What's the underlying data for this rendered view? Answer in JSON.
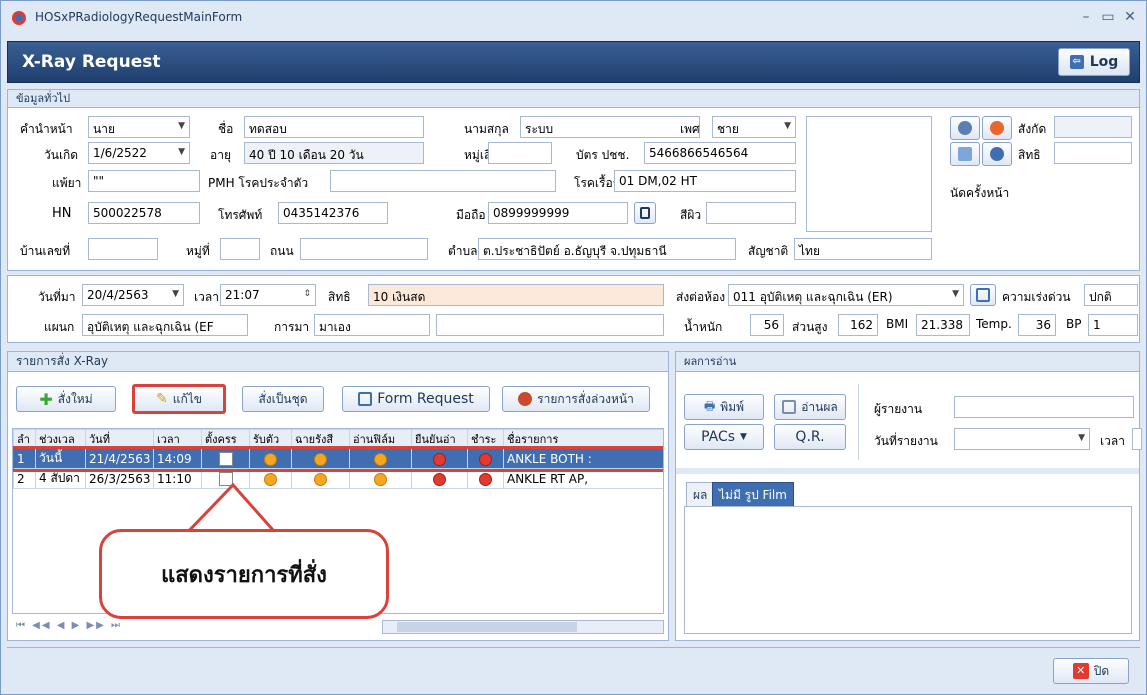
{
  "window": {
    "title": "HOSxPRadiologyRequestMainForm"
  },
  "header": {
    "title": "X-Ray Request",
    "log_label": "Log"
  },
  "general": {
    "section_title": "ข้อมูลทั่วไป",
    "prefix_label": "คำนำหน้า",
    "prefix_value": "นาย",
    "name_label": "ชื่อ",
    "name_value": "ทดสอบ",
    "surname_label": "นามสกุล",
    "surname_value": "ระบบ",
    "sex_label": "เพศ",
    "sex_value": "ชาย",
    "birth_label": "วันเกิด",
    "birth_value": "1/6/2522",
    "age_label": "อายุ",
    "age_value": "40 ปี 10 เดือน 20 วัน",
    "blood_label": "หมู่เลือด",
    "blood_value": "",
    "cid_label": "บัตร ปชช.",
    "cid_value": "5466866546564",
    "allergy_label": "แพ้ยา",
    "allergy_value": "\"\"",
    "pmh_label": "PMH โรคประจำตัว",
    "pmh_value": "",
    "chronic_label": "โรคเรื้อรัง",
    "chronic_value": "01 DM,02 HT",
    "hn_label": "HN",
    "hn_value": "500022578",
    "phone_label": "โทรศัพท์",
    "phone_value": "0435142376",
    "mobile_label": "มือถือ",
    "mobile_value": "0899999999",
    "skin_label": "สีผิว",
    "skin_value": "",
    "house_label": "บ้านเลขที่",
    "house_value": "",
    "moo_label": "หมู่ที่",
    "moo_value": "",
    "road_label": "ถนน",
    "road_value": "",
    "tambon_label": "ตำบล",
    "tambon_value": "ต.ประชาธิปัตย์ อ.ธัญบุรี จ.ปทุมธานี",
    "nation_label": "สัญชาติ",
    "nation_value": "ไทย",
    "affil_label": "สังกัด",
    "right_label": "สิทธิ",
    "appoint_label": "นัดครั้งหน้า"
  },
  "visit": {
    "date_label": "วันที่มา",
    "date_value": "20/4/2563",
    "time_label": "เวลา",
    "time_value": "21:07",
    "right_label": "สิทธิ",
    "right_value": "10 เงินสด",
    "send_label": "ส่งต่อห้อง",
    "send_value": "011 อุบัติเหตุ และฉุกเฉิน (ER)",
    "urgency_label": "ความเร่งด่วน",
    "urgency_value": "ปกติ",
    "dept_label": "แผนก",
    "dept_value": "อุบัติเหตุ และฉุกเฉิน (EF",
    "come_label": "การมา",
    "come_value": "มาเอง",
    "weight_label": "น้ำหนัก",
    "weight_value": "56",
    "height_label": "ส่วนสูง",
    "height_value": "162",
    "bmi_label": "BMI",
    "bmi_value": "21.338",
    "temp_label": "Temp.",
    "temp_value": "36",
    "bp_label": "BP",
    "bp_value": "1"
  },
  "orders": {
    "section_title": "รายการสั่ง X-Ray",
    "new_label": "สั่งใหม่",
    "edit_label": "แก้ไข",
    "set_label": "สั่งเป็นชุด",
    "form_label": "Form Request",
    "advance_label": "รายการสั่งล่วงหน้า",
    "columns": [
      "ลำ",
      "ช่วงเวล",
      "วันที่",
      "เวลา",
      "ตั้งครร",
      "รับตัว",
      "ฉายรังสี",
      "อ่านฟิล์ม",
      "ยืนยันอ่า",
      "ชำระ",
      "ชื่อรายการ"
    ],
    "rows": [
      {
        "no": "1",
        "period": "วันนี้",
        "date": "21/4/2563",
        "time": "14:09",
        "item": "ANKLE BOTH :"
      },
      {
        "no": "2",
        "period": "4 สัปดา",
        "date": "26/3/2563",
        "time": "11:10",
        "item": "ANKLE RT AP,"
      }
    ],
    "callout": "แสดงรายการที่สั่ง"
  },
  "reading": {
    "section_title": "ผลการอ่าน",
    "print_label": "พิมพ์",
    "read_label": "อ่านผล",
    "pacs_label": "PACs",
    "qr_label": "Q.R.",
    "reporter_label": "ผู้รายงาน",
    "reporter_value": "",
    "report_date_label": "วันที่รายงาน",
    "report_date_value": "",
    "time_label": "เวลา",
    "tab_result": "ผล",
    "tab_nofilm": "ไม่มี รูป Film"
  },
  "footer": {
    "close_label": "ปิด"
  },
  "colors": {
    "accent": "#1f3f6e",
    "highlight": "#d9413b",
    "right_bg": "#fde9d9"
  }
}
